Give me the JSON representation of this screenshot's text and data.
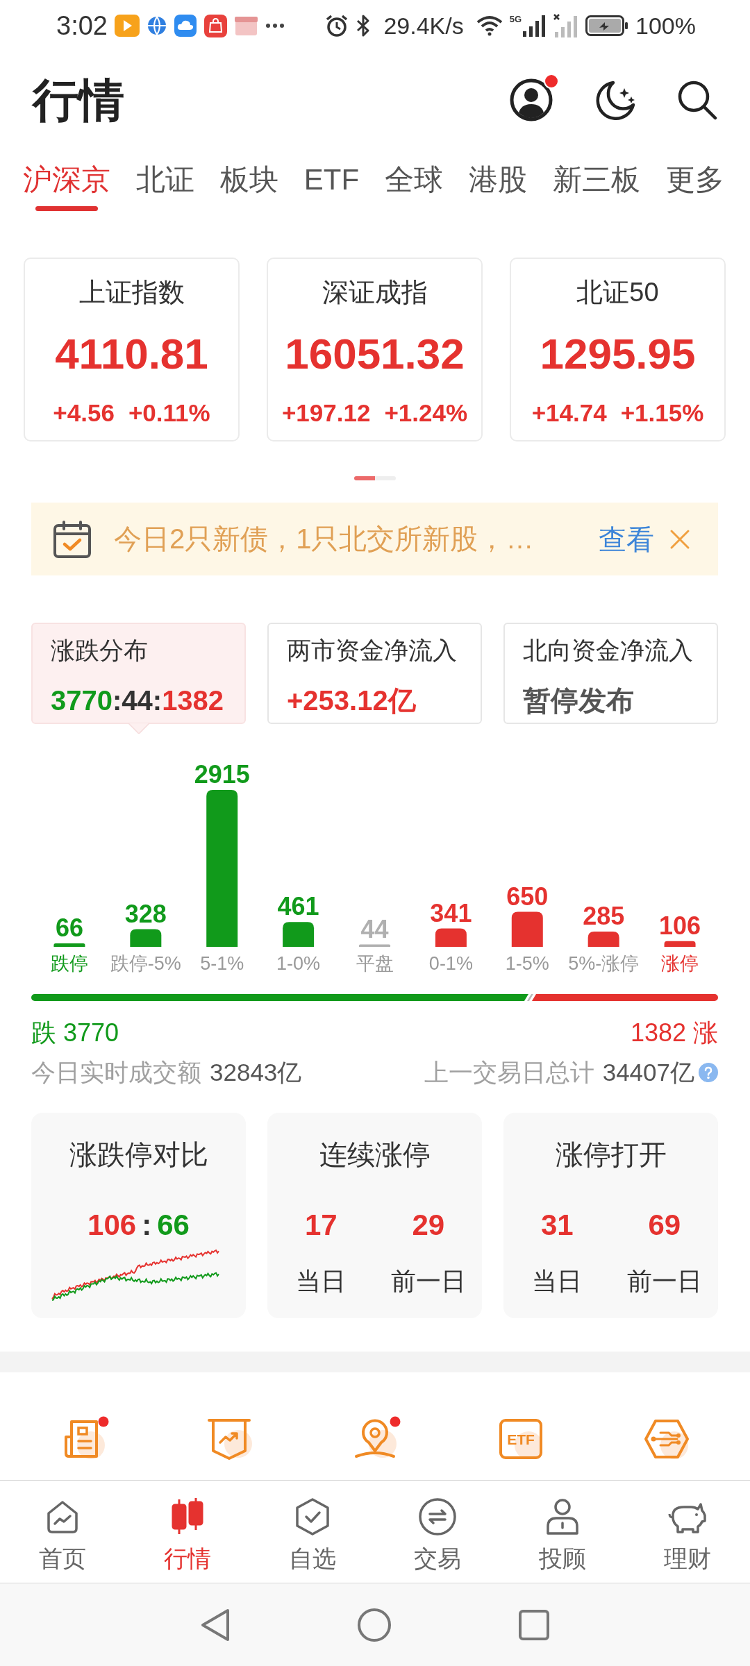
{
  "status_bar": {
    "time": "3:02",
    "network_speed": "29.4K/s",
    "network_type": "5G",
    "battery": "100%"
  },
  "header": {
    "title": "行情",
    "profile_badge": true
  },
  "tabs": [
    {
      "label": "沪深京",
      "selected": true
    },
    {
      "label": "北证",
      "selected": false
    },
    {
      "label": "板块",
      "selected": false
    },
    {
      "label": "ETF",
      "selected": false
    },
    {
      "label": "全球",
      "selected": false
    },
    {
      "label": "港股",
      "selected": false
    },
    {
      "label": "新三板",
      "selected": false
    },
    {
      "label": "更多",
      "selected": false
    }
  ],
  "index_cards": [
    {
      "name": "上证指数",
      "value": "4110.81",
      "change": "+4.56",
      "change_percent": "+0.11%",
      "rising": true
    },
    {
      "name": "深证成指",
      "value": "16051.32",
      "change": "+197.12",
      "change_percent": "+1.24%",
      "rising": true
    },
    {
      "name": "北证50",
      "value": "1295.95",
      "change": "+14.74",
      "change_percent": "+1.15%",
      "rising": true
    }
  ],
  "pager": [
    {
      "selected": true
    },
    {
      "selected": false
    }
  ],
  "notice": {
    "text": "今日2只新债，1只北交所新股，…",
    "action": "查看"
  },
  "stat_boxes": [
    {
      "title": "涨跌分布",
      "selected": true,
      "value_parts": [
        {
          "text": "3770",
          "color": "#119a1b"
        },
        {
          "text": ":44:",
          "color": "#333333"
        },
        {
          "text": "1382",
          "color": "#e5322f"
        }
      ]
    },
    {
      "title": "两市资金净流入",
      "selected": false,
      "value_parts": [
        {
          "text": "+253.12亿",
          "color": "#e5322f"
        }
      ]
    },
    {
      "title": "北向资金净流入",
      "selected": false,
      "value_parts": [
        {
          "text": "暂停发布",
          "color": "#555555"
        }
      ]
    }
  ],
  "distribution": {
    "chart_data": {
      "type": "bar",
      "categories": [
        "跌停",
        "跌停-5%",
        "5-1%",
        "1-0%",
        "平盘",
        "0-1%",
        "1-5%",
        "5%-涨停",
        "涨停"
      ],
      "series": [
        {
          "color": "#119a1b",
          "values": [
            66,
            328,
            2915,
            461,
            null,
            null,
            null,
            null,
            null
          ]
        },
        {
          "color": "#b0b0b0",
          "values": [
            null,
            null,
            null,
            null,
            44,
            null,
            null,
            null,
            null
          ]
        },
        {
          "color": "#e5322f",
          "values": [
            null,
            null,
            null,
            null,
            null,
            341,
            650,
            285,
            106
          ]
        }
      ],
      "data_labels": true
    }
  },
  "balance": {
    "level": 0.73,
    "fall_text": "跌 3770",
    "rise_text": "1382 涨"
  },
  "turnover": {
    "today_label": "今日实时成交额",
    "today_value": "32843亿",
    "previous_label": "上一交易日总计",
    "previous_value": "34407亿"
  },
  "summary_cards": [
    {
      "kind": "ratio",
      "title": "涨跌停对比",
      "parts": [
        {
          "text": "106",
          "color": "#e5322f"
        },
        {
          "text": ":",
          "color": "#333333"
        },
        {
          "text": "66",
          "color": "#119a1b"
        }
      ]
    },
    {
      "kind": "pair",
      "title": "连续涨停",
      "items": [
        {
          "value": "17",
          "label": "当日"
        },
        {
          "value": "29",
          "label": "前一日"
        }
      ]
    },
    {
      "kind": "pair",
      "title": "涨停打开",
      "items": [
        {
          "value": "31",
          "label": "当日"
        },
        {
          "value": "69",
          "label": "前一日"
        }
      ]
    }
  ],
  "shortcuts": [
    {
      "kind": "news",
      "badge": true
    },
    {
      "kind": "trend",
      "badge": false
    },
    {
      "kind": "location",
      "badge": true
    },
    {
      "kind": "etf",
      "text": "ETF",
      "badge": false
    },
    {
      "kind": "circuit",
      "badge": false
    }
  ],
  "bottom_nav": [
    {
      "kind": "home",
      "label": "首页",
      "selected": false
    },
    {
      "kind": "market",
      "label": "行情",
      "selected": true
    },
    {
      "kind": "watchlist",
      "label": "自选",
      "selected": false
    },
    {
      "kind": "trade",
      "label": "交易",
      "selected": false
    },
    {
      "kind": "advisor",
      "label": "投顾",
      "selected": false
    },
    {
      "kind": "wealth",
      "label": "理财",
      "selected": false
    }
  ]
}
